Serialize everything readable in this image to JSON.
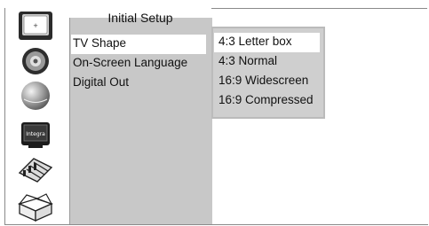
{
  "menu": {
    "title": "Initial Setup",
    "items": [
      {
        "label": "TV Shape",
        "selected": true
      },
      {
        "label": "On-Screen Language",
        "selected": false
      },
      {
        "label": "Digital Out",
        "selected": false
      }
    ]
  },
  "submenu": {
    "options": [
      {
        "label": "4:3 Letter box",
        "selected": true
      },
      {
        "label": "4:3 Normal",
        "selected": false
      },
      {
        "label": "16:9 Widescreen",
        "selected": false
      },
      {
        "label": "16:9 Compressed",
        "selected": false
      }
    ]
  },
  "sidebar": {
    "icons": [
      {
        "name": "tv-screen-icon"
      },
      {
        "name": "speaker-icon"
      },
      {
        "name": "globe-icon"
      },
      {
        "name": "integra-logo-icon",
        "text": "Integra"
      },
      {
        "name": "equalizer-remote-icon"
      },
      {
        "name": "box-icon"
      }
    ]
  },
  "colors": {
    "menu_bg": "#c8c8c8",
    "selected_bg": "#ffffff",
    "text": "#111111"
  }
}
